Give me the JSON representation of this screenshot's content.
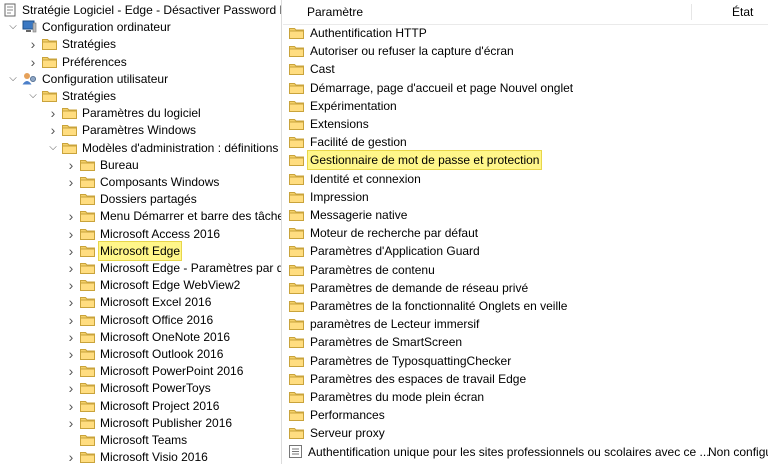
{
  "tree": {
    "items": [
      {
        "label": "Stratégie Logiciel - Edge - Désactiver Password Mar",
        "icon": "policy-doc-icon",
        "chevron": ""
      },
      {
        "label": "Configuration ordinateur",
        "icon": "computer-icon",
        "chevron": "down"
      },
      {
        "label": "Stratégies",
        "icon": "folder-icon",
        "chevron": "right"
      },
      {
        "label": "Préférences",
        "icon": "folder-icon",
        "chevron": "right"
      },
      {
        "label": "Configuration utilisateur",
        "icon": "user-icon",
        "chevron": "down"
      },
      {
        "label": "Stratégies",
        "icon": "folder-icon",
        "chevron": "down"
      },
      {
        "label": "Paramètres du logiciel",
        "icon": "folder-icon",
        "chevron": "right"
      },
      {
        "label": "Paramètres Windows",
        "icon": "folder-icon",
        "chevron": "right"
      },
      {
        "label": "Modèles d'administration : définitions d",
        "icon": "folder-icon",
        "chevron": "down"
      },
      {
        "label": "Bureau",
        "icon": "folder-icon",
        "chevron": "right"
      },
      {
        "label": "Composants Windows",
        "icon": "folder-icon",
        "chevron": "right"
      },
      {
        "label": "Dossiers partagés",
        "icon": "folder-icon",
        "chevron": ""
      },
      {
        "label": "Menu Démarrer et barre des tâches",
        "icon": "folder-icon",
        "chevron": "right"
      },
      {
        "label": "Microsoft Access 2016",
        "icon": "folder-icon",
        "chevron": "right"
      },
      {
        "label": "Microsoft Edge",
        "icon": "folder-icon",
        "chevron": "right",
        "selected": true
      },
      {
        "label": "Microsoft Edge - Paramètres par défa",
        "icon": "folder-icon",
        "chevron": "right"
      },
      {
        "label": "Microsoft Edge WebView2",
        "icon": "folder-icon",
        "chevron": "right"
      },
      {
        "label": "Microsoft Excel 2016",
        "icon": "folder-icon",
        "chevron": "right"
      },
      {
        "label": "Microsoft Office 2016",
        "icon": "folder-icon",
        "chevron": "right"
      },
      {
        "label": "Microsoft OneNote 2016",
        "icon": "folder-icon",
        "chevron": "right"
      },
      {
        "label": "Microsoft Outlook 2016",
        "icon": "folder-icon",
        "chevron": "right"
      },
      {
        "label": "Microsoft PowerPoint 2016",
        "icon": "folder-icon",
        "chevron": "right"
      },
      {
        "label": "Microsoft PowerToys",
        "icon": "folder-icon",
        "chevron": "right"
      },
      {
        "label": "Microsoft Project 2016",
        "icon": "folder-icon",
        "chevron": "right"
      },
      {
        "label": "Microsoft Publisher 2016",
        "icon": "folder-icon",
        "chevron": "right"
      },
      {
        "label": "Microsoft Teams",
        "icon": "folder-icon",
        "chevron": ""
      },
      {
        "label": "Microsoft Visio 2016",
        "icon": "folder-icon",
        "chevron": "right"
      }
    ]
  },
  "list": {
    "header_name": "Paramètre",
    "header_state": "État",
    "rows": [
      {
        "label": "Authentification HTTP",
        "icon": "folder-icon"
      },
      {
        "label": "Autoriser ou refuser la capture d'écran",
        "icon": "folder-icon"
      },
      {
        "label": "Cast",
        "icon": "folder-icon"
      },
      {
        "label": "Démarrage, page d'accueil et page Nouvel onglet",
        "icon": "folder-icon"
      },
      {
        "label": "Expérimentation",
        "icon": "folder-icon"
      },
      {
        "label": "Extensions",
        "icon": "folder-icon"
      },
      {
        "label": "Facilité de gestion",
        "icon": "folder-icon"
      },
      {
        "label": "Gestionnaire de mot de passe et protection",
        "icon": "folder-icon",
        "selected": true
      },
      {
        "label": "Identité et connexion",
        "icon": "folder-icon"
      },
      {
        "label": "Impression",
        "icon": "folder-icon"
      },
      {
        "label": "Messagerie native",
        "icon": "folder-icon"
      },
      {
        "label": "Moteur de recherche par défaut",
        "icon": "folder-icon"
      },
      {
        "label": "Paramètres d'Application Guard",
        "icon": "folder-icon"
      },
      {
        "label": "Paramètres de contenu",
        "icon": "folder-icon"
      },
      {
        "label": "Paramètres de demande de réseau privé",
        "icon": "folder-icon"
      },
      {
        "label": "Paramètres de la fonctionnalité Onglets en veille",
        "icon": "folder-icon"
      },
      {
        "label": "paramètres de Lecteur immersif",
        "icon": "folder-icon"
      },
      {
        "label": "Paramètres de SmartScreen",
        "icon": "folder-icon"
      },
      {
        "label": "Paramètres de TyposquattingChecker",
        "icon": "folder-icon"
      },
      {
        "label": "Paramètres des espaces de travail Edge",
        "icon": "folder-icon"
      },
      {
        "label": "Paramètres du mode plein écran",
        "icon": "folder-icon"
      },
      {
        "label": "Performances",
        "icon": "folder-icon"
      },
      {
        "label": "Serveur proxy",
        "icon": "folder-icon"
      },
      {
        "label": "Authentification unique pour les sites professionnels ou scolaires avec ce ...",
        "icon": "setting-icon",
        "state": "Non configu"
      }
    ]
  },
  "colors": {
    "highlight": "#fff68a",
    "folder": "#e8c35a"
  }
}
